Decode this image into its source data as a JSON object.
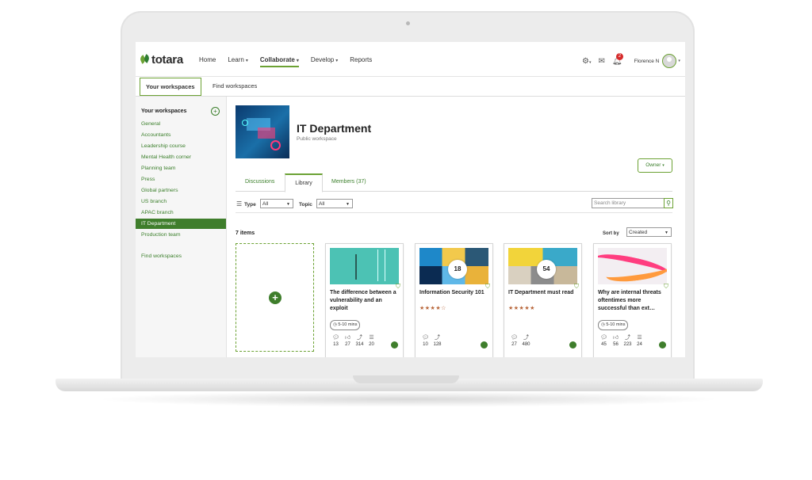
{
  "topbar": {
    "logo": "totara",
    "nav": [
      {
        "label": "Home",
        "caret": ""
      },
      {
        "label": "Learn",
        "caret": "▾"
      },
      {
        "label": "Collaborate",
        "caret": "▾"
      },
      {
        "label": "Develop",
        "caret": "▾"
      },
      {
        "label": "Reports",
        "caret": ""
      }
    ],
    "notification_count": "2",
    "user_name": "Florence N"
  },
  "subnav": {
    "your_workspaces": "Your workspaces",
    "find_workspaces": "Find workspaces"
  },
  "sidebar": {
    "heading": "Your workspaces",
    "add_icon": "+",
    "items": [
      "General",
      "Accountants",
      "Leadership course",
      "Mental Health corner",
      "Planning team",
      "Press",
      "Global partners",
      "US branch",
      "APAC branch",
      "IT Department",
      "Production team"
    ],
    "selected": "IT Department",
    "find_link": "Find workspaces"
  },
  "workspace": {
    "title": "IT Department",
    "subtitle": "Public workspace",
    "owner_button": "Owner",
    "owner_caret": "▾"
  },
  "tabs": [
    "Discussions",
    "Library",
    "Members (37)"
  ],
  "filters": {
    "type_label": "Type",
    "type_value": "All",
    "topic_label": "Topic",
    "topic_value": "All",
    "search_placeholder": "Search library"
  },
  "library": {
    "count_text": "7 items",
    "sort_label": "Sort by",
    "sort_value": "Created",
    "add_icon": "+",
    "cards": [
      {
        "title": "The difference between a vulnerability and an exploit",
        "duration": "5-10 mins",
        "comments": "13",
        "likes": "27",
        "shares": "314",
        "playlists": "20"
      },
      {
        "title": "Information Security 101",
        "stars": "★★★★☆",
        "hub_count": "18",
        "comments": "10",
        "shares": "128"
      },
      {
        "title": "IT Department must read",
        "stars": "★★★★★",
        "hub_count": "54",
        "comments": "27",
        "shares": "480"
      },
      {
        "title": "Why are internal threats oftentimes more successful than ext…",
        "duration": "5-10 mins",
        "comments": "45",
        "likes": "56",
        "shares": "223",
        "playlists": "24"
      }
    ]
  },
  "colors": {
    "brand_green": "#3f7e2c",
    "accent_green": "#6ca234"
  }
}
